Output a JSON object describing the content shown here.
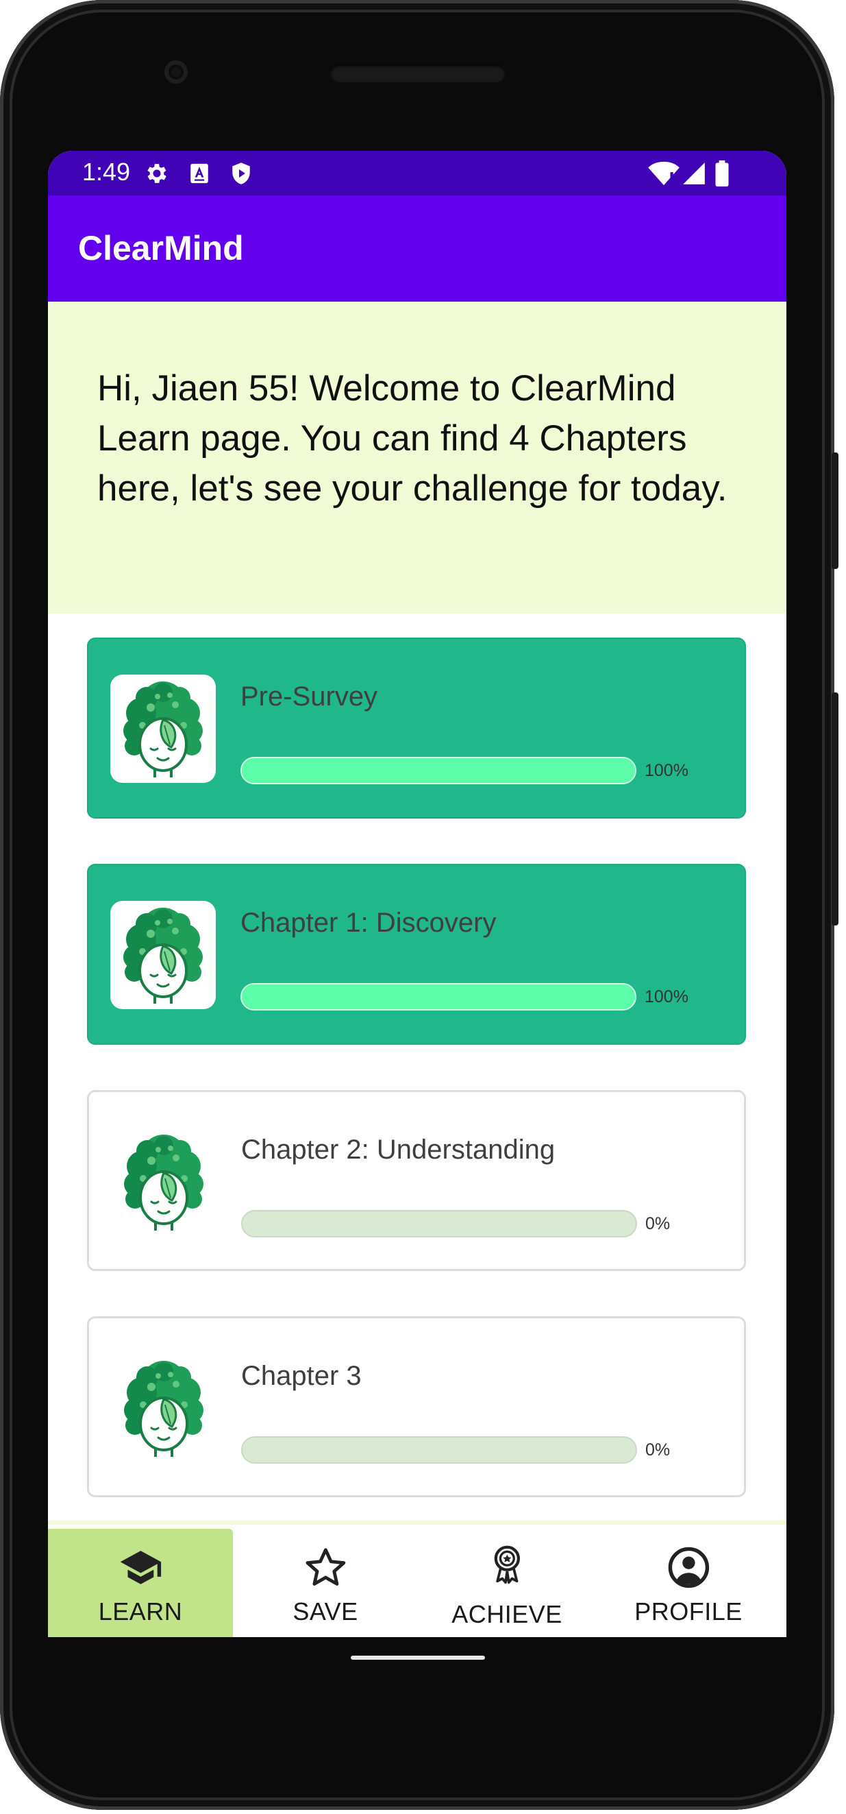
{
  "status_bar": {
    "time": "1:49",
    "left_icons": [
      "settings-icon",
      "text-a-icon",
      "shield-play-icon"
    ],
    "right_icons": [
      "wifi-icon",
      "signal-icon",
      "battery-icon"
    ],
    "background": "#4003b6"
  },
  "app_bar": {
    "title": "ClearMind",
    "background": "#6200ee"
  },
  "welcome": {
    "text": "Hi, Jiaen 55! Welcome to ClearMind Learn page. You can find 4 Chapters here, let's see your challenge for today.",
    "background": "#f1fbd6"
  },
  "chapters": [
    {
      "title": "Pre-Survey",
      "progress_label": "100%",
      "progress": 1.0,
      "completed": true,
      "icon": "clearmind-logo-icon"
    },
    {
      "title": "Chapter 1: Discovery",
      "progress_label": "100%",
      "progress": 1.0,
      "completed": true,
      "icon": "clearmind-logo-icon"
    },
    {
      "title": "Chapter 2: Understanding",
      "progress_label": "0%",
      "progress": 0.0,
      "completed": false,
      "icon": "clearmind-logo-icon"
    },
    {
      "title": "Chapter 3",
      "progress_label": "0%",
      "progress": 0.0,
      "completed": false,
      "icon": "clearmind-logo-icon"
    }
  ],
  "colors": {
    "completed_card": "#20b88a",
    "completed_bar": "#5dfca8",
    "empty_bar": "#d9e9d3",
    "active_nav": "#c1e38a"
  },
  "bottom_nav": [
    {
      "label": "LEARN",
      "icon": "graduation-cap-icon",
      "active": true
    },
    {
      "label": "SAVE",
      "icon": "star-icon",
      "active": false
    },
    {
      "label": "ACHIEVE",
      "icon": "award-ribbon-icon",
      "active": false
    },
    {
      "label": "PROFILE",
      "icon": "account-circle-icon",
      "active": false
    }
  ]
}
